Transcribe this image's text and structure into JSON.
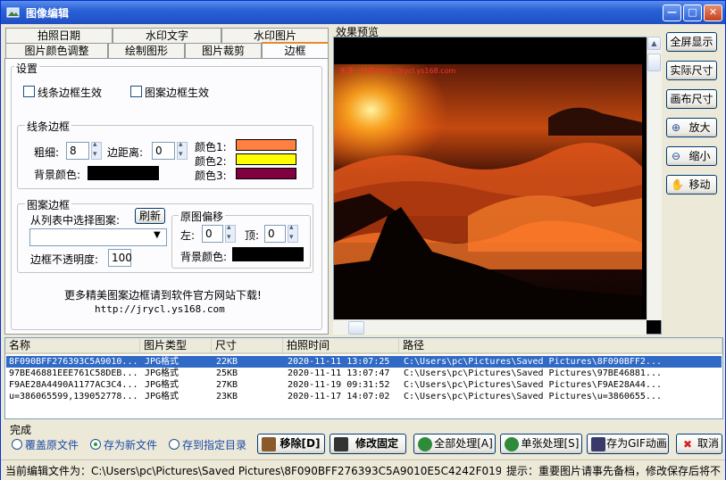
{
  "window": {
    "title": "图像编辑",
    "controls": [
      "0",
      "1",
      "r"
    ]
  },
  "tabs_top": [
    "拍照日期",
    "水印文字",
    "水印图片"
  ],
  "tabs_bottom": [
    "图片颜色调整",
    "绘制图形",
    "图片裁剪",
    "边框"
  ],
  "settings": {
    "title": "设置",
    "line_border_enable": "线条边框生效",
    "pattern_border_enable": "图案边框生效",
    "line_border": {
      "title": "线条边框",
      "thickness_label": "粗细:",
      "thickness_value": "8",
      "margin_label": "边距离:",
      "margin_value": "0",
      "bg_color_label": "背景颜色:",
      "bg_color": "#000000",
      "color1_label": "颜色1:",
      "color1": "#ff8040",
      "color2_label": "颜色2:",
      "color2": "#ffff00",
      "color3_label": "颜色3:",
      "color3": "#800040"
    },
    "pattern_border": {
      "title": "图案边框",
      "select_label": "从列表中选择图案:",
      "refresh_label": "刷新",
      "select_value": "",
      "opacity_label": "边框不透明度:",
      "opacity_value": "100",
      "offset_title": "原图偏移",
      "left_label": "左:",
      "left_value": "0",
      "top_label": "顶:",
      "top_value": "0",
      "bg_color_label": "背景颜色:",
      "bg_color": "#000000"
    },
    "download_hint": "更多精美图案边框请到软件官方网站下载!",
    "download_url": "http://jrycl.ys168.com"
  },
  "preview": {
    "title": "效果预览",
    "watermark": "天涯一叶舟 http://jrycl.ys168.com"
  },
  "tools": [
    "全屏显示",
    "实际尺寸",
    "画布尺寸",
    "放大",
    "缩小",
    "移动"
  ],
  "file_list": {
    "columns": [
      "名称",
      "图片类型",
      "尺寸",
      "拍照时间",
      "路径"
    ],
    "rows": [
      [
        "8F090BFF276393C5A9010...",
        "JPG格式",
        "22KB",
        "2020-11-11 13:07:25",
        "C:\\Users\\pc\\Pictures\\Saved Pictures\\8F090BFF2..."
      ],
      [
        "97BE46881EEE761C58DEB...",
        "JPG格式",
        "25KB",
        "2020-11-11 13:07:47",
        "C:\\Users\\pc\\Pictures\\Saved Pictures\\97BE46881..."
      ],
      [
        "F9AE28A4490A1177AC3C4...",
        "JPG格式",
        "27KB",
        "2020-11-19 09:31:52",
        "C:\\Users\\pc\\Pictures\\Saved Pictures\\F9AE28A44..."
      ],
      [
        "u=386065599,139052778...",
        "JPG格式",
        "23KB",
        "2020-11-17 14:07:02",
        "C:\\Users\\pc\\Pictures\\Saved Pictures\\u=3860655..."
      ]
    ]
  },
  "bottom": {
    "done_label": "完成",
    "options": [
      "覆盖原文件",
      "存为新文件",
      "存到指定目录"
    ],
    "selected_option": 1,
    "buttons": [
      "移除[D]",
      "修改固定",
      "全部处理[A]",
      "单张处理[S]",
      "存为GIF动画",
      "取消"
    ]
  },
  "status": {
    "current_file": "当前编辑文件为：C:\\Users\\pc\\Pictures\\Saved Pictures\\8F090BFF276393C5A9010E5C4242F019.jpg",
    "tip": "提示：重要图片请事先备档，修改保存后将不"
  }
}
